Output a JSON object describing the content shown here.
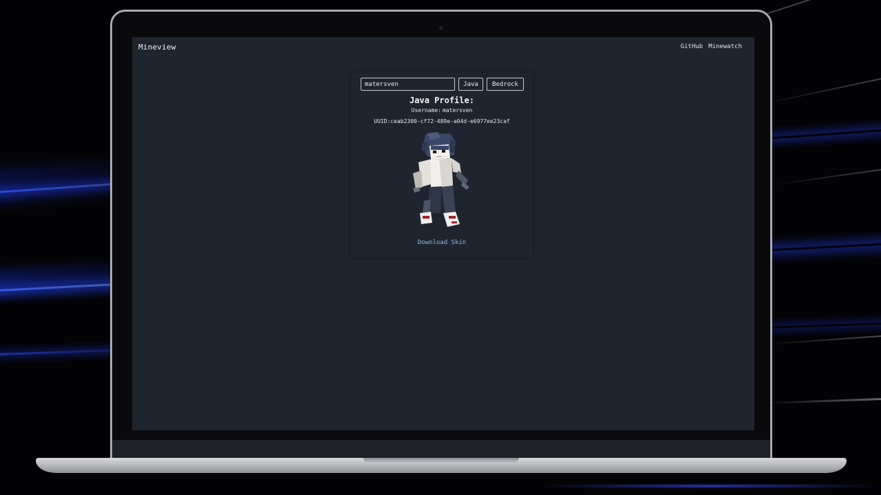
{
  "app": {
    "brand": "Mineview",
    "nav_links": [
      "GitHub",
      "Minewatch"
    ]
  },
  "search": {
    "value": "matersven",
    "java_label": "Java",
    "bedrock_label": "Bedrock"
  },
  "profile": {
    "title": "Java Profile:",
    "username_label": "Username:",
    "username": "matersven",
    "uuid_label": "UUID:",
    "uuid": "ceab2300-cf72-489e-a04d-e6977ee23caf"
  },
  "download_label": "Download Skin",
  "colors": {
    "screen_bg": "#1f252e",
    "link_accent": "#8fb6e8",
    "backdrop_blue": "#2a4cff"
  }
}
